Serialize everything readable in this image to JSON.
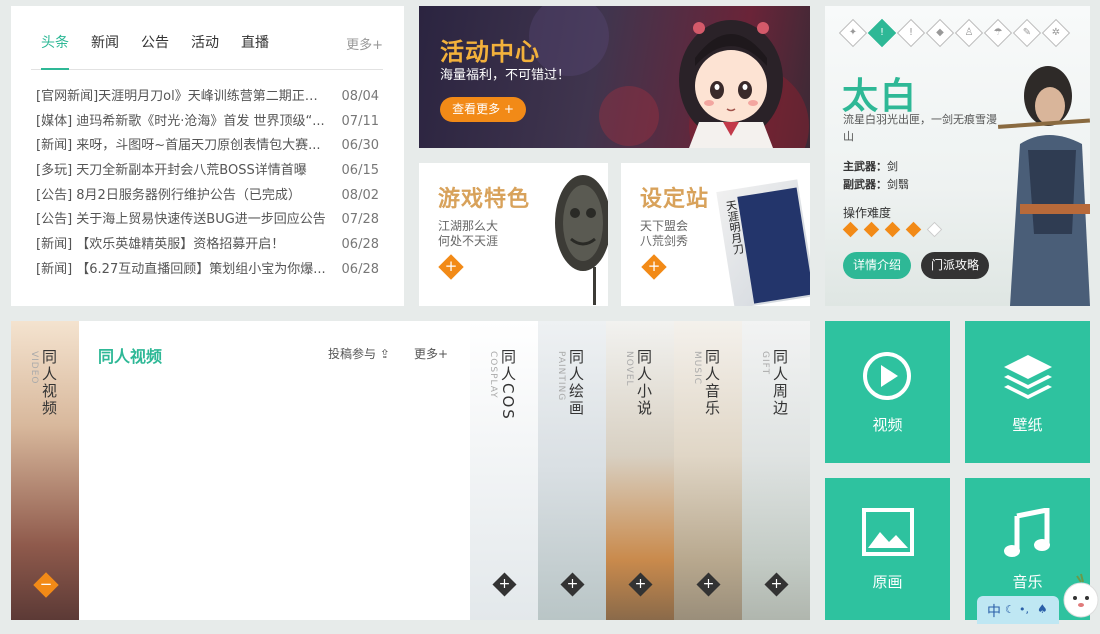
{
  "news": {
    "tabs": [
      "头条",
      "新闻",
      "公告",
      "活动",
      "直播"
    ],
    "more": "更多+",
    "items": [
      {
        "title": "[官网新闻]天涯明月刀ol》天峰训练营第二期正式...",
        "date": "08/04"
      },
      {
        "title": "[媒体]  迪玛希新歌《时光·沧海》首发 世界顶级“...",
        "date": "07/11"
      },
      {
        "title": "[新闻]  来呀，斗图呀~首届天刀原创表情包大赛...",
        "date": "06/30"
      },
      {
        "title": "[多玩]  天刀全新副本开封会八荒BOSS详情首曝",
        "date": "06/15"
      },
      {
        "title": "[公告]  8月2日服务器例行维护公告（已完成）",
        "date": "08/02"
      },
      {
        "title": "[公告]  关于海上贸易快速传送BUG进一步回应公告",
        "date": "07/28"
      },
      {
        "title": "[新闻]  【欢乐英雄精英服】资格招募开启！",
        "date": "06/28"
      },
      {
        "title": "[新闻]  【6.27互动直播回顾】策划组小宝为你爆...",
        "date": "06/28"
      }
    ]
  },
  "activity": {
    "title": "活动中心",
    "subtitle": "海量福利，不可错过！",
    "button": "查看更多 +"
  },
  "feature_card": {
    "title": "游戏特色",
    "line1": "江湖那么大",
    "line2": "何处不天涯",
    "plus": "+"
  },
  "setting_card": {
    "title": "设定站",
    "line1": "天下盟会",
    "line2": "八荒剑秀",
    "plus": "+",
    "book_text": "天涯明月刀"
  },
  "character": {
    "name": "太白",
    "desc": "流星白羽光出匣，一剑无痕雪漫山",
    "weapon_main_label": "主武器：",
    "weapon_main": "剑",
    "weapon_sub_label": "副武器：",
    "weapon_sub": "剑翳",
    "difficulty_label": "操作难度",
    "difficulty": 4,
    "difficulty_max": 5,
    "btn_detail": "详情介绍",
    "btn_guide": "门派攻略",
    "class_icons": [
      "sword-class-icon",
      "taibai-class-icon",
      "tangmen-class-icon",
      "shenwei-class-icon",
      "gaibang-class-icon",
      "tianxiang-class-icon",
      "zhenwu-class-icon",
      "wudu-class-icon"
    ]
  },
  "fanart": {
    "title": "同人视频",
    "submit": "投稿参与",
    "more": "更多+",
    "left_tab": {
      "cn": "同人视频",
      "en": "VIDEO",
      "minus": "−"
    },
    "strips": [
      {
        "cn": "同人COS",
        "en": "COSPLAY",
        "plus": "+"
      },
      {
        "cn": "同人绘画",
        "en": "PAINTING",
        "plus": "+"
      },
      {
        "cn": "同人小说",
        "en": "NOVEL",
        "plus": "+"
      },
      {
        "cn": "同人音乐",
        "en": "MUSIC",
        "plus": "+"
      },
      {
        "cn": "同人周边",
        "en": "GIFT",
        "plus": "+"
      }
    ]
  },
  "tiles": [
    {
      "label": "视频",
      "icon": "play-icon"
    },
    {
      "label": "壁纸",
      "icon": "layers-icon"
    },
    {
      "label": "原画",
      "icon": "image-icon"
    },
    {
      "label": "音乐",
      "icon": "music-note-icon"
    }
  ],
  "corner": {
    "lang": "中"
  },
  "colors": {
    "accent": "#2eb896",
    "orange": "#f28a17",
    "tile": "#2ec29f"
  }
}
